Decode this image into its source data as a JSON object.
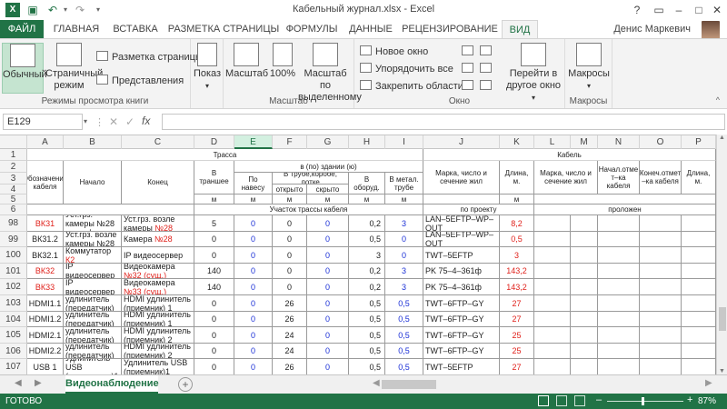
{
  "window": {
    "title": "Кабельный журнал.xlsx - Excel",
    "user": "Денис Маркевич"
  },
  "tabs": {
    "file": "ФАЙЛ",
    "items": [
      "ГЛАВНАЯ",
      "ВСТАВКА",
      "РАЗМЕТКА СТРАНИЦЫ",
      "ФОРМУЛЫ",
      "ДАННЫЕ",
      "РЕЦЕНЗИРОВАНИЕ",
      "ВИД"
    ],
    "active": "ВИД"
  },
  "ribbon": {
    "normal": "Обычный",
    "page_mode_1": "Страничный",
    "page_mode_2": "режим",
    "page_layout": "Разметка страницы",
    "views": "Представления",
    "group_views": "Режимы просмотра книги",
    "show": "Показ",
    "zoom": "Масштаб",
    "zoom100": "100%",
    "zoom_sel_1": "Масштаб по",
    "zoom_sel_2": "выделенному",
    "group_zoom": "Масштаб",
    "new_window": "Новое окно",
    "arrange": "Упорядочить все",
    "freeze": "Закрепить области",
    "switch_1": "Перейти в",
    "switch_2": "другое окно",
    "group_window": "Окно",
    "macros": "Макросы",
    "group_macros": "Макросы"
  },
  "formula_bar": {
    "name_box": "E129",
    "cancel": "✕",
    "enter": "✓",
    "fx": "fx",
    "value": ""
  },
  "columns": [
    "A",
    "B",
    "C",
    "D",
    "E",
    "F",
    "G",
    "H",
    "I",
    "J",
    "K",
    "L",
    "M",
    "N",
    "O",
    "P"
  ],
  "header_rows": [
    "1",
    "2",
    "3",
    "4",
    "5",
    "6"
  ],
  "header": {
    "trassa": "Трасса",
    "kabel": "Кабель",
    "bpo": "в (по) здании (ю)",
    "oboz": "Обозначение кабеля",
    "nachalo": "Начало",
    "konec": "Конец",
    "transh": "В траншее",
    "naves": "По навесу",
    "truba": "В трубе,коробе, лотке",
    "otkr": "открыто",
    "skr": "скрыто",
    "oborud": "В оборуд.",
    "metal": "В метал. трубе",
    "marka": "Марка, число и сечение жил",
    "dlina": "Длина, м.",
    "marka2": "Марка, число и сечение жил",
    "nach_otm": "Начал.отме т–ка кабеля",
    "kon_otm": "Конеч.отмет –ка кабеля",
    "dlina2": "Длина, м.",
    "m": "м",
    "uchastok": "Участок трассы кабеля",
    "proekt": "по проекту",
    "prolozhen": "проложен"
  },
  "rows": [
    {
      "num": "98",
      "a": "ВК31",
      "a_red": true,
      "b": "Уст.грз. камеры №28 в шкафу",
      "b_red": false,
      "c": "Уст.грз. возле камеры №28",
      "c_red": true,
      "d": "5",
      "e": "0",
      "f": "0",
      "g": "0",
      "h": "0,2",
      "i": "3",
      "j": "LAN–5EFTP–WP–OUT",
      "k": "8,2"
    },
    {
      "num": "99",
      "a": "ВК31.2",
      "a_red": false,
      "b": "Уст.грз. возле камеры №28",
      "b_red": false,
      "c": "Камера №28",
      "c_red": true,
      "d": "0",
      "e": "0",
      "f": "0",
      "g": "0",
      "h": "0,5",
      "i": "0",
      "j": "LAN–5EFTP–WP–OUT",
      "k": "0,5"
    },
    {
      "num": "100",
      "a": "ВК32.1",
      "a_red": false,
      "b": "Коммутатор К2",
      "b_red": true,
      "c": "IP видеосервер",
      "c_red": false,
      "d": "0",
      "e": "0",
      "f": "0",
      "g": "0",
      "h": "3",
      "i": "0",
      "j": "TWT–5EFTP",
      "k": "3"
    },
    {
      "num": "101",
      "a": "ВК32",
      "a_red": true,
      "b": "IP видеосервер",
      "b_red": false,
      "c": "Видеокамера №32 (сущ.)",
      "c_red": true,
      "d": "140",
      "e": "0",
      "f": "0",
      "g": "0",
      "h": "0,2",
      "i": "3",
      "j": "PK 75–4–361ф",
      "k": "143,2"
    },
    {
      "num": "102",
      "a": "ВК33",
      "a_red": true,
      "b": "IP видеосервер",
      "b_red": false,
      "c": "Видеокамера №33 (сущ.)",
      "c_red": true,
      "d": "140",
      "e": "0",
      "f": "0",
      "g": "0",
      "h": "0,2",
      "i": "3",
      "j": "PK 75–4–361ф",
      "k": "143,2"
    },
    {
      "num": "103",
      "a": "HDMI1.1",
      "a_red": false,
      "b": "HDMI удлинитель (передатчик) 1",
      "b_red": false,
      "c": "HDMI удлинитель (приемник) 1",
      "c_red": false,
      "d": "0",
      "e": "0",
      "f": "26",
      "g": "0",
      "h": "0,5",
      "i": "0,5",
      "j": "TWT–6FTP–GY",
      "k": "27"
    },
    {
      "num": "104",
      "a": "HDMI1.2",
      "a_red": false,
      "b": "HDMI удлинитель (передатчик) 1",
      "b_red": false,
      "c": "HDMI удлинитель (приемник) 1",
      "c_red": false,
      "d": "0",
      "e": "0",
      "f": "26",
      "g": "0",
      "h": "0,5",
      "i": "0,5",
      "j": "TWT–6FTP–GY",
      "k": "27"
    },
    {
      "num": "105",
      "a": "HDMI2.1",
      "a_red": false,
      "b": "HDMI удлинитель (передатчик) 2",
      "b_red": false,
      "c": "HDMI удлинитель (приемник) 2",
      "c_red": false,
      "d": "0",
      "e": "0",
      "f": "24",
      "g": "0",
      "h": "0,5",
      "i": "0,5",
      "j": "TWT–6FTP–GY",
      "k": "25"
    },
    {
      "num": "106",
      "a": "HDMI2.2",
      "a_red": false,
      "b": "HDMI удлинитель (передатчик) 2",
      "b_red": false,
      "c": "HDMI удлинитель (приемник) 2",
      "c_red": false,
      "d": "0",
      "e": "0",
      "f": "24",
      "g": "0",
      "h": "0,5",
      "i": "0,5",
      "j": "TWT–6FTP–GY",
      "k": "25"
    },
    {
      "num": "107",
      "a": "USB 1",
      "a_red": false,
      "b": "Удлинитель USB (передатчик)1",
      "b_red": false,
      "c": "Удлинитель USB (приемник)1",
      "c_red": false,
      "d": "0",
      "e": "0",
      "f": "26",
      "g": "0",
      "h": "0,5",
      "i": "0,5",
      "j": "TWT–5EFTP",
      "k": "27"
    }
  ],
  "sheet": {
    "name": "Видеонаблюдение",
    "add": "+"
  },
  "status": {
    "ready": "ГОТОВО",
    "zoom": "87%",
    "minus": "–",
    "plus": "+"
  },
  "colors": {
    "accent": "#217346",
    "red": "#e0211b",
    "blue": "#1a2fd6"
  }
}
